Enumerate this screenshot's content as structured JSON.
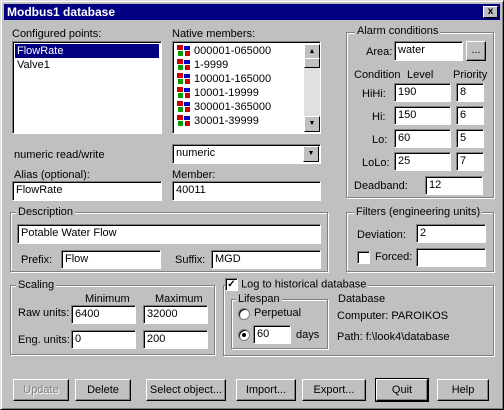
{
  "window": {
    "title": "Modbus1 database",
    "close_label": "x"
  },
  "configured": {
    "label": "Configured points:",
    "items": [
      "FlowRate",
      "Valve1"
    ],
    "selected": 0
  },
  "native": {
    "label": "Native members:",
    "items": [
      "000001-065000",
      "1-9999",
      "100001-165000",
      "10001-19999",
      "300001-365000",
      "30001-39999"
    ]
  },
  "numeric": {
    "label": "numeric read/write",
    "select_value": "numeric"
  },
  "alias": {
    "label": "Alias (optional):",
    "value": "FlowRate"
  },
  "member": {
    "label": "Member:",
    "value": "40011"
  },
  "description": {
    "group_label": "Description",
    "value": "Potable Water Flow",
    "prefix_label": "Prefix:",
    "prefix_value": "Flow",
    "suffix_label": "Suffix:",
    "suffix_value": "MGD"
  },
  "scaling": {
    "group_label": "Scaling",
    "min_label": "Minimum",
    "max_label": "Maximum",
    "raw_label": "Raw units:",
    "raw_min": "6400",
    "raw_max": "32000",
    "eng_label": "Eng. units:",
    "eng_min": "0",
    "eng_max": "200"
  },
  "log": {
    "label": "Log to historical database",
    "checked": true
  },
  "lifespan": {
    "group_label": "Lifespan",
    "perpetual_label": "Perpetual",
    "days_value": "60",
    "days_label": "days"
  },
  "database": {
    "group_label": "Database",
    "computer": "Computer: PAROIKOS",
    "path": "Path: f:\\look4\\database"
  },
  "alarm": {
    "group_label": "Alarm conditions",
    "area_label": "Area:",
    "area_value": "water",
    "browse_label": "...",
    "condition_label": "Condition",
    "level_label": "Level",
    "priority_label": "Priority",
    "rows": [
      {
        "name": "HiHi:",
        "level": "190",
        "priority": "8"
      },
      {
        "name": "Hi:",
        "level": "150",
        "priority": "6"
      },
      {
        "name": "Lo:",
        "level": "60",
        "priority": "5"
      },
      {
        "name": "LoLo:",
        "level": "25",
        "priority": "7"
      }
    ],
    "deadband_label": "Deadband:",
    "deadband_value": "12"
  },
  "filters": {
    "group_label": "Filters (engineering units)",
    "deviation_label": "Deviation:",
    "deviation_value": "2",
    "forced_label": "Forced:",
    "forced_value": ""
  },
  "buttons": {
    "update": "Update",
    "delete": "Delete",
    "select": "Select object...",
    "import": "Import...",
    "export": "Export...",
    "quit": "Quit",
    "help": "Help"
  }
}
